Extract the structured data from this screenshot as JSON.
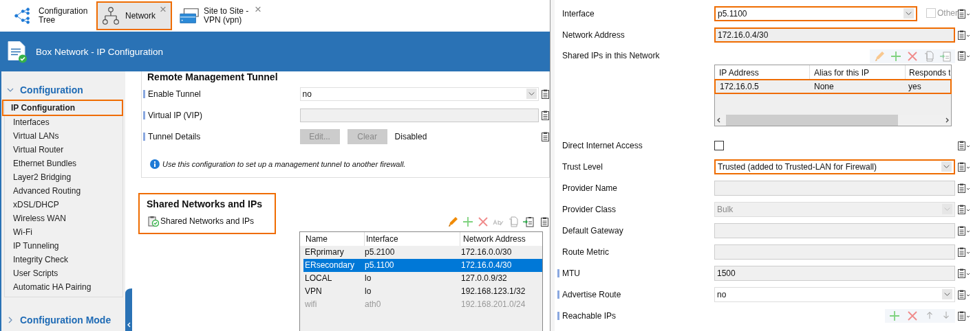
{
  "tabs": [
    {
      "label": "Configuration Tree",
      "selected": false,
      "highlighted": false
    },
    {
      "label": "Network",
      "selected": true,
      "highlighted": true,
      "close": "×"
    },
    {
      "label": "Site to Site - VPN (vpn)",
      "selected": false,
      "highlighted": false,
      "close": "×"
    }
  ],
  "header": {
    "title": "Box Network - IP Configuration"
  },
  "sidebar": {
    "section": {
      "label": "Configuration",
      "expanded": true
    },
    "items": [
      {
        "label": "IP Configuration",
        "selected": true,
        "highlighted": true
      },
      {
        "label": "Interfaces",
        "selected": false,
        "highlighted": false
      },
      {
        "label": "Virtual LANs",
        "selected": false,
        "highlighted": false
      },
      {
        "label": "Virtual Router",
        "selected": false,
        "highlighted": false
      },
      {
        "label": "Ethernet Bundles",
        "selected": false,
        "highlighted": false
      },
      {
        "label": "Layer2 Bridging",
        "selected": false,
        "highlighted": false
      },
      {
        "label": "Advanced Routing",
        "selected": false,
        "highlighted": false
      },
      {
        "label": "xDSL/DHCP",
        "selected": false,
        "highlighted": false
      },
      {
        "label": "Wireless WAN",
        "selected": false,
        "highlighted": false
      },
      {
        "label": "Wi-Fi",
        "selected": false,
        "highlighted": false
      },
      {
        "label": "IP Tunneling",
        "selected": false,
        "highlighted": false
      },
      {
        "label": "Integrity Check",
        "selected": false,
        "highlighted": false
      },
      {
        "label": "User Scripts",
        "selected": false,
        "highlighted": false
      },
      {
        "label": "Automatic HA Pairing",
        "selected": false,
        "highlighted": false
      }
    ],
    "footer_section": {
      "label": "Configuration Mode",
      "expanded": false
    }
  },
  "remote_tunnel": {
    "title": "Remote Management Tunnel",
    "rows": [
      {
        "kind": "select",
        "label": "Enable Tunnel",
        "value": "no"
      },
      {
        "kind": "text",
        "label": "Virtual IP (VIP)"
      },
      {
        "kind": "buttons",
        "label": "Tunnel Details",
        "buttons": [
          {
            "label": "Edit...",
            "disabled": true
          },
          {
            "label": "Clear",
            "disabled": true
          }
        ],
        "status": "Disabled"
      }
    ],
    "info": "Use this configuration to set up a management tunnel to another firewall."
  },
  "shared_networks": {
    "title": "Shared Networks and IPs",
    "highlighted": true,
    "item_label": "Shared Networks and IPs",
    "table": {
      "columns": [
        "Name",
        "Interface",
        "Network Address"
      ],
      "rows": [
        {
          "cells": [
            "ERprimary",
            "p5.2100",
            "172.16.0.0/30"
          ],
          "selected": false,
          "disabled": false
        },
        {
          "cells": [
            "ERsecondary",
            "p5.1100",
            "172.16.0.4/30"
          ],
          "selected": true,
          "disabled": false
        },
        {
          "cells": [
            "LOCAL",
            "lo",
            "127.0.0.9/32"
          ],
          "selected": false,
          "disabled": false
        },
        {
          "cells": [
            "VPN",
            "lo",
            "192.168.123.1/32"
          ],
          "selected": false,
          "disabled": false
        },
        {
          "cells": [
            "wifi",
            "ath0",
            "192.168.201.0/24"
          ],
          "selected": false,
          "disabled": true
        }
      ]
    }
  },
  "details": [
    {
      "kind": "select",
      "label": "Interface",
      "value": "p5.1100",
      "marker": false,
      "highlighted": true,
      "disabled": false,
      "other": {
        "label": "Other",
        "checked": false
      }
    },
    {
      "kind": "text",
      "label": "Network Address",
      "value": "172.16.0.4/30",
      "marker": false,
      "highlighted": true
    },
    {
      "kind": "table",
      "label": "Shared IPs in this Network",
      "marker": false,
      "columns": [
        "IP Address",
        "Alias for this IP",
        "Responds t"
      ],
      "rows": [
        {
          "cells": [
            "172.16.0.5",
            "None",
            "yes"
          ],
          "highlighted": true
        }
      ]
    },
    {
      "kind": "checkbox",
      "label": "Direct Internet Access",
      "checked": false,
      "marker": false
    },
    {
      "kind": "select",
      "label": "Trust Level",
      "value": "Trusted (added to Trusted-LAN for Firewall)",
      "marker": false,
      "highlighted": true,
      "disabled": false
    },
    {
      "kind": "text",
      "label": "Provider Name",
      "marker": false,
      "highlighted": false
    },
    {
      "kind": "select",
      "label": "Provider Class",
      "value": "Bulk",
      "marker": false,
      "highlighted": false,
      "disabled": true
    },
    {
      "kind": "text",
      "label": "Default Gateway",
      "marker": false,
      "highlighted": false
    },
    {
      "kind": "text",
      "label": "Route Metric",
      "marker": false,
      "highlighted": false
    },
    {
      "kind": "text",
      "label": "MTU",
      "value": "1500",
      "marker": true,
      "highlighted": false
    },
    {
      "kind": "select",
      "label": "Advertise Route",
      "value": "no",
      "marker": true,
      "highlighted": false,
      "disabled": false
    },
    {
      "kind": "list",
      "label": "Reachable IPs",
      "marker": true
    }
  ]
}
